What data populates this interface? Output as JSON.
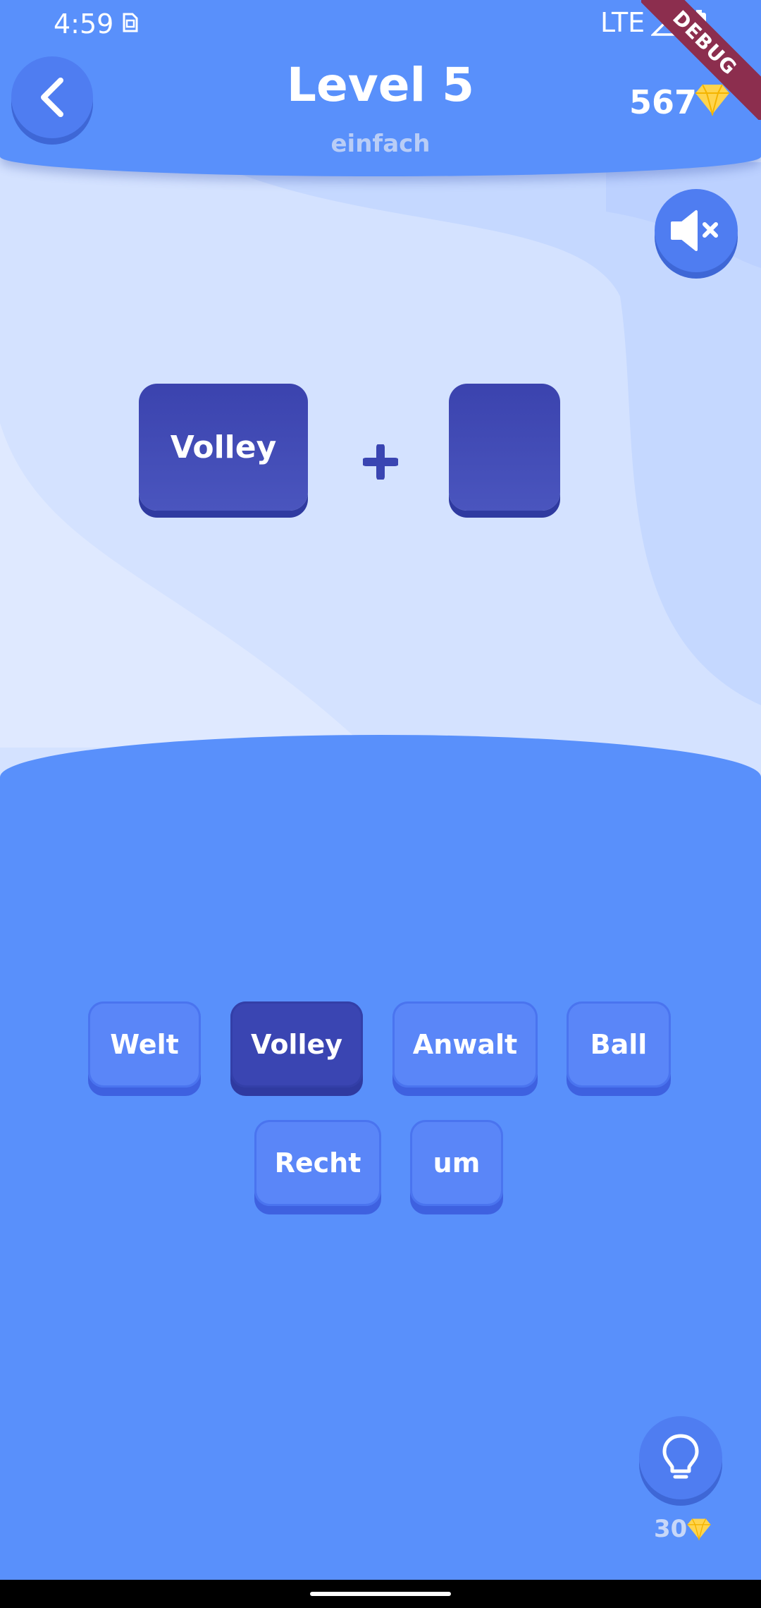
{
  "status_bar": {
    "time": "4:59",
    "network": "LTE"
  },
  "header": {
    "title": "Level 5",
    "subtitle": "einfach",
    "coins": "567"
  },
  "debug_banner": "DEBUG",
  "colors": {
    "primary": "#5990fb",
    "tile_dark": "#3a45b2",
    "gem": "#ffd44d",
    "ribbon": "#8c2e4e"
  },
  "puzzle": {
    "slots": [
      "Volley",
      ""
    ],
    "operator": "+"
  },
  "word_tiles": [
    {
      "label": "Welt",
      "used": false
    },
    {
      "label": "Volley",
      "used": true
    },
    {
      "label": "Anwalt",
      "used": false
    },
    {
      "label": "Ball",
      "used": false
    },
    {
      "label": "Recht",
      "used": false
    },
    {
      "label": "um",
      "used": false
    }
  ],
  "hint": {
    "cost": "30"
  },
  "icons": {
    "back": "chevron-left-icon",
    "mute": "speaker-muted-icon",
    "hint": "lightbulb-icon",
    "currency": "diamond-icon"
  }
}
